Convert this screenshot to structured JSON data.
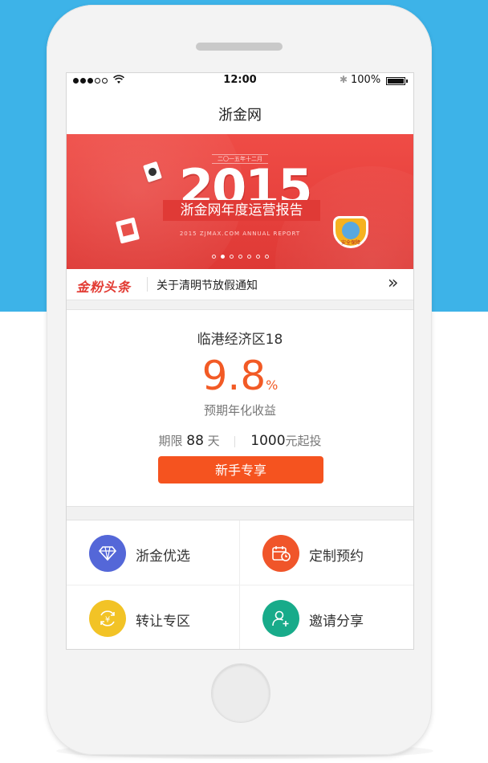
{
  "status": {
    "time": "12:00",
    "battery": "100%"
  },
  "nav": {
    "title": "浙金网"
  },
  "banner": {
    "tag": "二〇一五年十二月",
    "year": "2015",
    "title": "浙金网年度运营报告",
    "subtitle": "2015 ZJMAX.COM ANNUAL REPORT",
    "badge": "安全保障",
    "slide_count": 7,
    "active_slide": 1
  },
  "news": {
    "logo": "金粉头条",
    "text": "关于清明节放假通知"
  },
  "product": {
    "name": "临港经济区18",
    "rate": "9.8",
    "rate_unit": "%",
    "rate_label": "预期年化收益",
    "term_prefix": "期限",
    "term_value": "88",
    "term_unit": "天",
    "min_value": "1000",
    "min_unit": "元起投",
    "button": "新手专享"
  },
  "grid": [
    {
      "label": "浙金优选",
      "icon": "diamond-icon",
      "color": "#5467d8"
    },
    {
      "label": "定制预约",
      "icon": "calendar-clock-icon",
      "color": "#f0552a"
    },
    {
      "label": "转让专区",
      "icon": "yuan-exchange-icon",
      "color": "#f2c326"
    },
    {
      "label": "邀请分享",
      "icon": "add-user-icon",
      "color": "#18ab8a"
    }
  ]
}
